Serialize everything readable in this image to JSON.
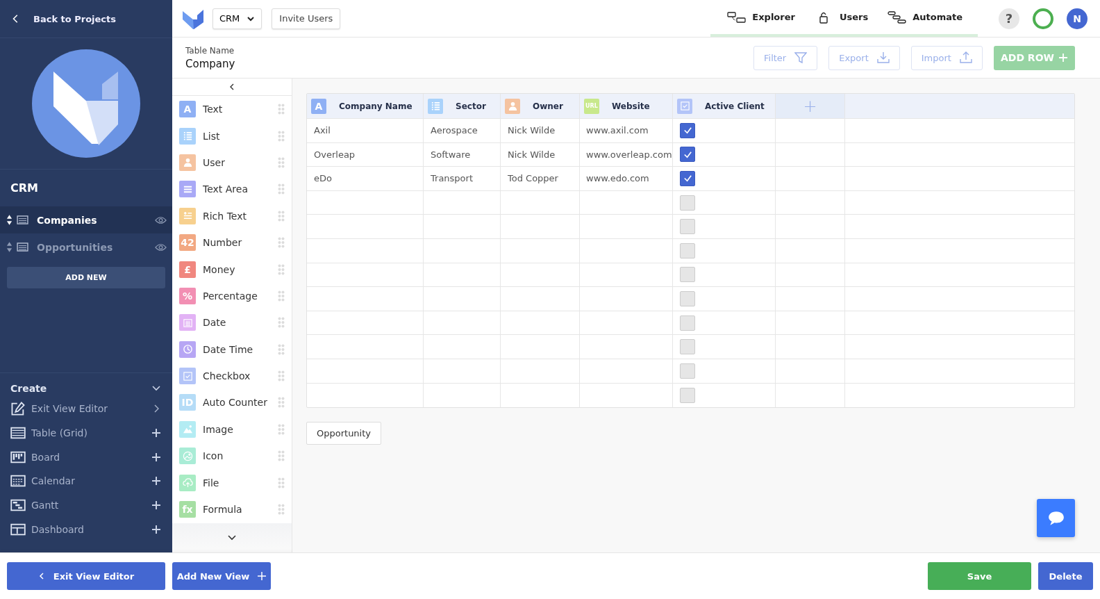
{
  "sidebar": {
    "back": "Back to Projects",
    "project": "CRM",
    "views": [
      {
        "label": "Companies",
        "selected": true
      },
      {
        "label": "Opportunities",
        "selected": false
      }
    ],
    "add_new": "ADD NEW",
    "create_title": "Create",
    "create_items": [
      {
        "kind": "editor",
        "label": "Exit View Editor",
        "submenu": true
      },
      {
        "kind": "grid",
        "label": "Table (Grid)",
        "submenu": false
      },
      {
        "kind": "board",
        "label": "Board",
        "submenu": false
      },
      {
        "kind": "calendar",
        "label": "Calendar",
        "submenu": false
      },
      {
        "kind": "gantt",
        "label": "Gantt",
        "submenu": false
      },
      {
        "kind": "dashboard",
        "label": "Dashboard",
        "submenu": false
      }
    ]
  },
  "topbar": {
    "app_menu": "CRM",
    "invite": "Invite Users",
    "nav": [
      {
        "kind": "explorer",
        "label": "Explorer"
      },
      {
        "kind": "users",
        "label": "Users"
      },
      {
        "kind": "automate",
        "label": "Automate"
      }
    ],
    "help": "?",
    "avatar": "N"
  },
  "table_name": {
    "label": "Table Name",
    "value": "Company"
  },
  "toolbar": {
    "filter": "Filter",
    "export": "Export",
    "import": "Import",
    "add_row": "ADD ROW"
  },
  "field_types": [
    {
      "kind": "badge",
      "badge": "A",
      "label": "Text",
      "color": "#8fb0f4"
    },
    {
      "kind": "list",
      "label": "List",
      "color": "#a9d2fb"
    },
    {
      "kind": "user",
      "label": "User",
      "color": "#f5c3a0"
    },
    {
      "kind": "textarea",
      "label": "Text Area",
      "color": "#a9a9f6"
    },
    {
      "kind": "richtext",
      "label": "Rich Text",
      "color": "#f7d08e"
    },
    {
      "kind": "badge",
      "badge": "42",
      "label": "Number",
      "color": "#f2a882"
    },
    {
      "kind": "badge",
      "badge": "£",
      "label": "Money",
      "color": "#f0877f"
    },
    {
      "kind": "badge",
      "badge": "%",
      "label": "Percentage",
      "color": "#f28fb3"
    },
    {
      "kind": "date",
      "label": "Date",
      "color": "#e2b2f5"
    },
    {
      "kind": "clock",
      "label": "Date Time",
      "color": "#b7a6f4"
    },
    {
      "kind": "checkbox",
      "label": "Checkbox",
      "color": "#b3c4f8"
    },
    {
      "kind": "badge",
      "badge": "ID",
      "label": "Auto Counter",
      "color": "#b5dcf7"
    },
    {
      "kind": "image",
      "label": "Image",
      "color": "#b3ecf3"
    },
    {
      "kind": "icon",
      "label": "Icon",
      "color": "#a9ecd6"
    },
    {
      "kind": "file",
      "label": "File",
      "color": "#a8ecc4"
    },
    {
      "kind": "badge",
      "badge": "fx",
      "label": "Formula",
      "color": "#a6dfa3"
    }
  ],
  "grid": {
    "columns": [
      {
        "kind": "badge",
        "badge": "A",
        "label": "Company Name",
        "color": "#8fb0f4"
      },
      {
        "kind": "list",
        "label": "Sector",
        "color": "#a9d2fb"
      },
      {
        "kind": "user",
        "label": "Owner",
        "color": "#f5c3a0"
      },
      {
        "kind": "badge",
        "badge": "URL",
        "label": "Website",
        "color": "#c8e88c"
      },
      {
        "kind": "checkbox",
        "label": "Active Client",
        "color": "#b3c4f8"
      }
    ],
    "add_column": "+",
    "rows": [
      {
        "cells": [
          "Axil",
          "Aerospace",
          "Nick Wilde",
          "www.axil.com"
        ],
        "active": true
      },
      {
        "cells": [
          "Overleap",
          "Software",
          "Nick Wilde",
          "www.overleap.com"
        ],
        "active": true
      },
      {
        "cells": [
          "eDo",
          "Transport",
          "Tod Copper",
          "www.edo.com"
        ],
        "active": true
      },
      {
        "active": false
      },
      {
        "active": false
      },
      {
        "active": false
      },
      {
        "active": false
      },
      {
        "active": false
      },
      {
        "active": false
      },
      {
        "active": false
      },
      {
        "active": false
      },
      {
        "active": false
      }
    ]
  },
  "linked_tables": [
    "Opportunity"
  ],
  "footer": {
    "exit": "Exit View Editor",
    "add_view": "Add New View",
    "save": "Save",
    "delete": "Delete"
  }
}
